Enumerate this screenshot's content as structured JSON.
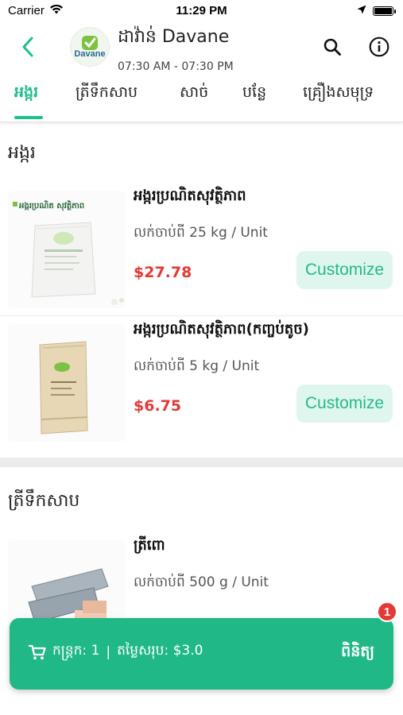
{
  "status_bar": {
    "carrier": "Carrier",
    "time": "11:29 PM"
  },
  "header": {
    "shop_name": "ដាវ៉ាន់ Davane",
    "hours": "07:30 AM - 07:30 PM",
    "logo_text": "Davane"
  },
  "tabs": [
    {
      "label": "អង្ករ",
      "active": true
    },
    {
      "label": "ត្រីទឹកសាប",
      "active": false
    },
    {
      "label": "សាច់",
      "active": false
    },
    {
      "label": "បន្លែ",
      "active": false
    },
    {
      "label": "គ្រឿងសមុទ្រ",
      "active": false
    }
  ],
  "sections": [
    {
      "title": "អង្ករ",
      "products": [
        {
          "name": "អង្ករប្រណិតសុវត្ថិភាព",
          "unit": "លក់ចាប់ពី 25 kg / Unit",
          "price": "$27.78",
          "button": "Customize",
          "image_caption": "អង្ករប្រណិត សុវត្ថិភាព"
        },
        {
          "name": "អង្ករប្រណិតសុវត្ថិភាព(កញ្ចប់តូច)",
          "unit": "លក់ចាប់ពី 5 kg / Unit",
          "price": "$6.75",
          "button": "Customize"
        }
      ]
    },
    {
      "title": "ត្រីទឹកសាប",
      "products": [
        {
          "name": "ត្រីពោ",
          "unit": "លក់ចាប់ពី 500 g / Unit"
        }
      ]
    }
  ],
  "cart": {
    "count_text": "កន្ត្រក: 1",
    "separator": "|",
    "total_text": "តម្លៃសរុប: $3.0",
    "checkout_label": "ពិនិត្យ",
    "badge": "1"
  },
  "colors": {
    "accent": "#1fbf8f",
    "price": "#e53935",
    "button_bg": "#dff6ee"
  }
}
